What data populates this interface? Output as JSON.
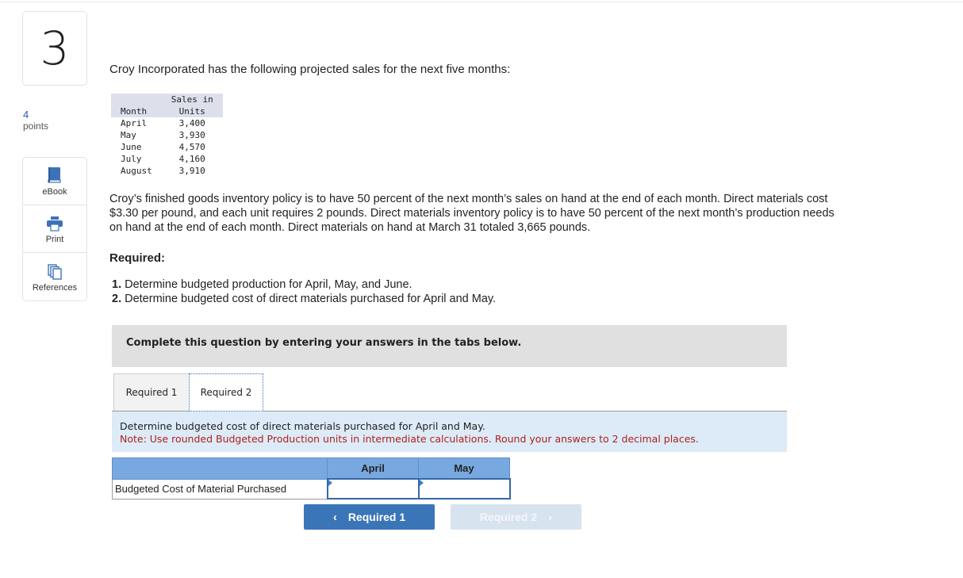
{
  "question": {
    "number": "3",
    "points_value": "4",
    "points_label": "points"
  },
  "tools": [
    {
      "label": "eBook",
      "icon": "book-icon"
    },
    {
      "label": "Print",
      "icon": "printer-icon"
    },
    {
      "label": "References",
      "icon": "documents-icon"
    }
  ],
  "problem": {
    "intro": "Croy Incorporated has the following projected sales for the next five months:",
    "table": {
      "headers": {
        "month": "Month",
        "units_line1": "Sales in",
        "units_line2": "Units"
      },
      "rows": [
        {
          "month": "April",
          "units": "3,400"
        },
        {
          "month": "May",
          "units": "3,930"
        },
        {
          "month": "June",
          "units": "4,570"
        },
        {
          "month": "July",
          "units": "4,160"
        },
        {
          "month": "August",
          "units": "3,910"
        }
      ]
    },
    "paragraph": "Croy’s finished goods inventory policy is to have 50 percent of the next month’s sales on hand at the end of each month. Direct materials cost $3.30 per pound, and each unit requires 2 pounds. Direct materials inventory policy is to have 50 percent of the next month’s production needs on hand at the end of each month. Direct materials on hand at March 31 totaled 3,665 pounds.",
    "required_title": "Required:",
    "required_items": [
      {
        "num": "1.",
        "text": " Determine budgeted production for April, May, and June."
      },
      {
        "num": "2.",
        "text": " Determine budgeted cost of direct materials purchased for April and May."
      }
    ]
  },
  "banner": "Complete this question by entering your answers in the tabs below.",
  "tabs": [
    {
      "label": "Required 1",
      "active": false
    },
    {
      "label": "Required 2",
      "active": true
    }
  ],
  "instructions": {
    "line1": "Determine budgeted cost of direct materials purchased for April and May.",
    "note": "Note: Use rounded Budgeted Production units in intermediate calculations. Round your answers to 2 decimal places."
  },
  "answer_table": {
    "columns": [
      "April",
      "May"
    ],
    "row_label": "Budgeted Cost of Material Purchased",
    "values": [
      "",
      ""
    ]
  },
  "nav": {
    "prev_label": "Required 1",
    "next_label": "Required 2",
    "next_disabled": true
  },
  "colors": {
    "accent": "#3a75b8",
    "note_red": "#b0211e",
    "table_header": "#77a9e0",
    "instruction_bg": "#dcebf7"
  }
}
